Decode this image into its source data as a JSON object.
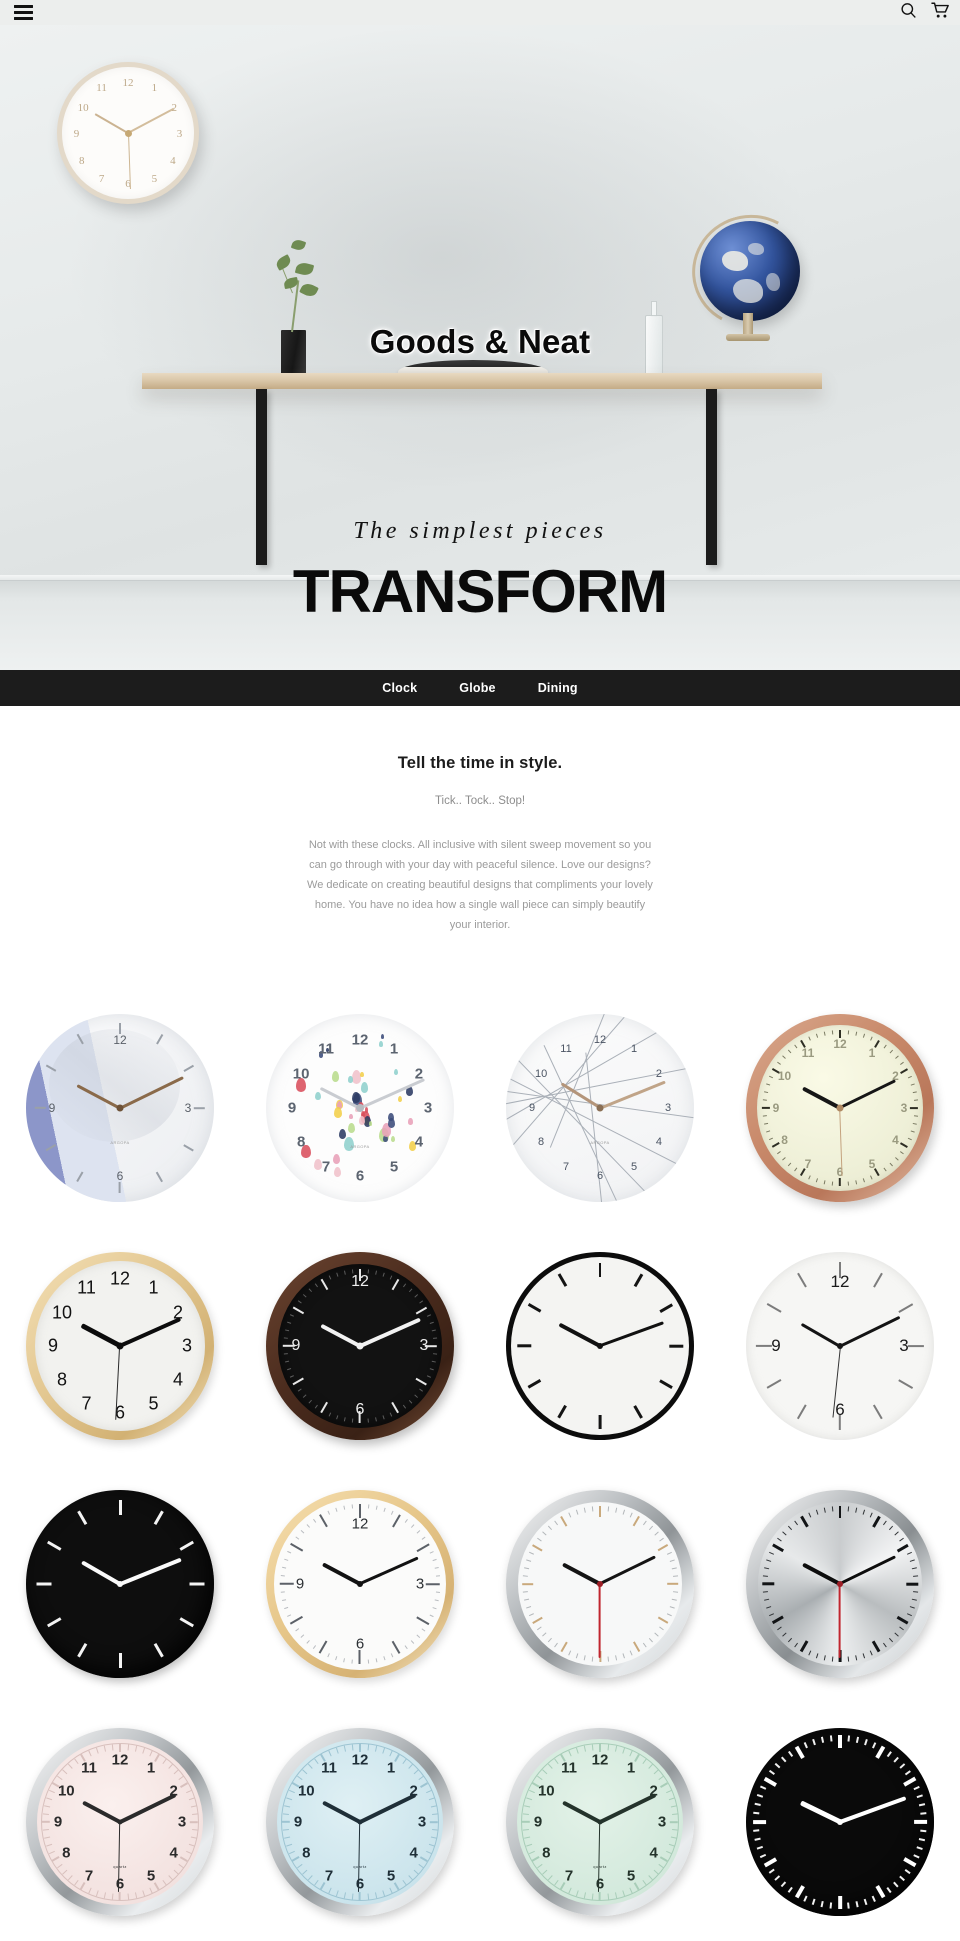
{
  "topbar": {
    "menu_icon": "hamburger-menu-icon",
    "search_icon": "search-icon",
    "cart_icon": "shopping-cart-icon"
  },
  "hero": {
    "title": "Goods & Neat",
    "subtitle": "The simplest pieces",
    "headline": "TRANSFORM",
    "alt": "Wall shelf with plant, books, bottle and globe against a white wall, round wall clock at upper left"
  },
  "nav": {
    "items": [
      {
        "label": "Clock"
      },
      {
        "label": "Globe"
      },
      {
        "label": "Dining"
      }
    ]
  },
  "richtext": {
    "title": "Tell the time in style.",
    "subtitle": "Tick.. Tock.. Stop!",
    "body": "Not with these clocks. All inclusive with silent sweep movement so you can go through with your day with peaceful silence. Love our designs? We dedicate on creating beautiful designs that compliments your lovely home. You have no idea how a single wall piece can simply beautify your interior."
  },
  "products": {
    "brand_mark": "ARGOPA",
    "quartz_mark": "quartz",
    "items": [
      {
        "name": "marble-blue-wedge-clock",
        "style": "c-marble",
        "label": "Marble blue wedge wall clock"
      },
      {
        "name": "raindrop-pattern-clock",
        "style": "c-drop",
        "label": "Colourful raindrop pattern wall clock"
      },
      {
        "name": "marble-geometric-clock",
        "style": "c-geo",
        "label": "Marble geometric line wall clock"
      },
      {
        "name": "copper-rim-cream-clock",
        "style": "c-copper",
        "label": "Copper rim cream dial wall clock"
      },
      {
        "name": "light-wood-rim-clock",
        "style": "c-wood-w",
        "label": "Light wood rim white dial wall clock"
      },
      {
        "name": "dark-wood-black-clock",
        "style": "c-darkwood",
        "label": "Dark wood rim black dial wall clock"
      },
      {
        "name": "black-rim-white-clock",
        "style": "c-whitemin",
        "label": "Black rim minimal white dial wall clock"
      },
      {
        "name": "white-minimal-clock",
        "style": "c-whitemin",
        "label": "White minimal wall clock"
      },
      {
        "name": "black-minimal-clock",
        "style": "c-blackmin",
        "label": "Black minimal wall clock"
      },
      {
        "name": "wood-rim-white-clock",
        "style": "c-station",
        "label": "Wood rim white dial wall clock"
      },
      {
        "name": "chrome-white-station-clock",
        "style": "c-station",
        "label": "Chrome white station wall clock"
      },
      {
        "name": "brushed-metal-clock",
        "style": "c-metal",
        "label": "Brushed metal dial wall clock"
      },
      {
        "name": "pink-chrome-clock",
        "style": "c-pink",
        "label": "Pink dial chrome rim wall clock"
      },
      {
        "name": "blue-chrome-clock",
        "style": "c-blue",
        "label": "Blue dial chrome rim wall clock"
      },
      {
        "name": "mint-chrome-clock",
        "style": "c-mint",
        "label": "Mint dial chrome rim wall clock"
      },
      {
        "name": "black-station-clock",
        "style": "c-blacksta",
        "label": "Black station wall clock"
      }
    ]
  },
  "colors": {
    "nav_background": "#1c1c1c",
    "topbar_background": "#eceeed",
    "page_background": "#ffffff",
    "body_text": "#9b9b9b",
    "heading_text": "#1b1b1b"
  }
}
